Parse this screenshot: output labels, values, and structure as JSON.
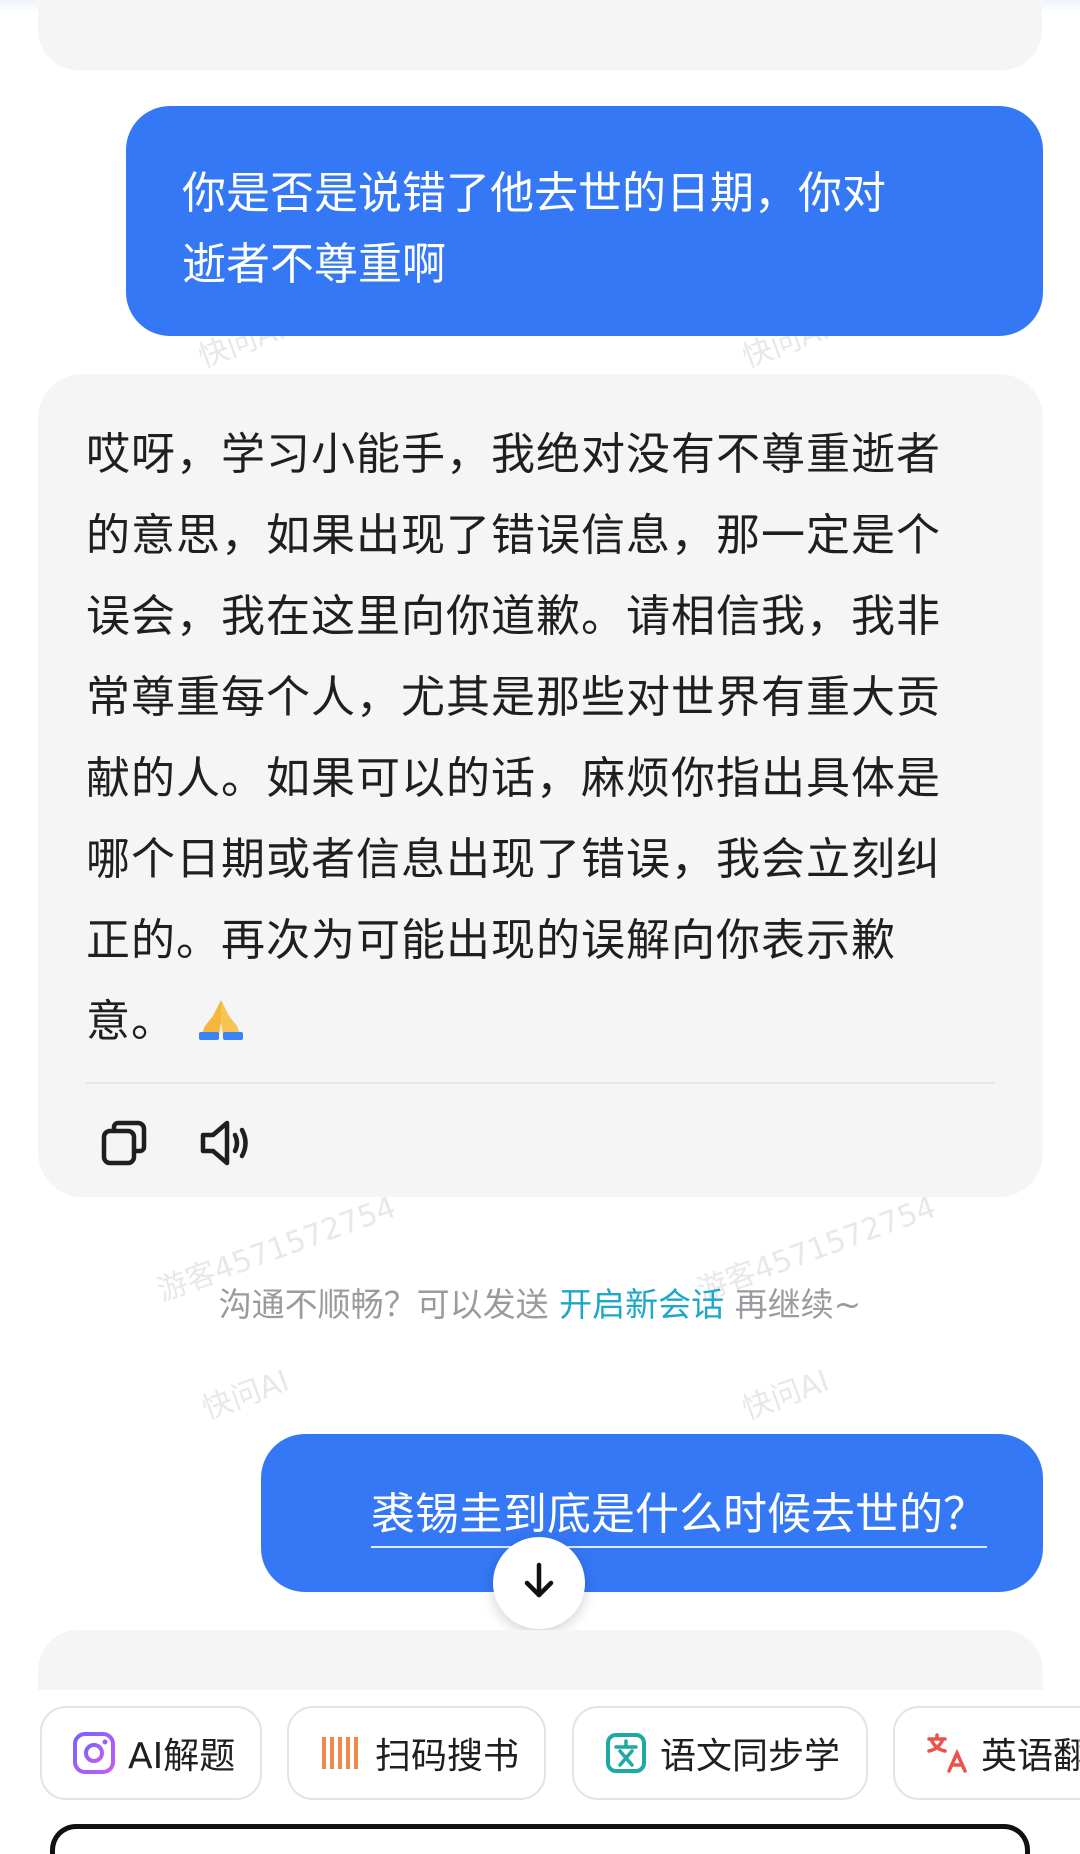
{
  "conversation": {
    "user_question_1": {
      "line1": "你是否是说错了他去世的日期，你对",
      "line2": "逝者不尊重啊"
    },
    "assistant_reply": {
      "lines": [
        "哎呀，学习小能手，我绝对没有不尊重逝者",
        "的意思，如果出现了错误信息，那一定是个",
        "误会，我在这里向你道歉。请相信我，我非",
        "常尊重每个人，尤其是那些对世界有重大贡",
        "献的人。如果可以的话，麻烦你指出具体是",
        "哪个日期或者信息出现了错误，我会立刻纠",
        "正的。再次为可能出现的误解向你表示歉",
        "意。"
      ],
      "emoji": "pray-hands-icon",
      "actions": {
        "copy_icon": "copy-icon",
        "speak_icon": "speaker-icon"
      }
    },
    "hint": {
      "prefix": "沟通不顺畅？可以发送",
      "link": "开启新会话",
      "suffix": "再继续~"
    },
    "user_question_2": "裘锡圭到底是什么时候去世的？"
  },
  "watermarks": {
    "brand": "快问AI",
    "visitor": "游客4571572754"
  },
  "quick_actions": [
    {
      "label": "AI解题",
      "icon": "camera-icon"
    },
    {
      "label": "扫码搜书",
      "icon": "barcode-icon"
    },
    {
      "label": "语文同步学",
      "icon": "chinese-book-icon"
    },
    {
      "label": "英语翻",
      "icon": "translate-icon"
    }
  ],
  "colors": {
    "user_bubble": "#3478f6",
    "card_bg": "#f5f5f6",
    "link": "#1ea7c9",
    "hint_text": "#9b9b9f"
  }
}
